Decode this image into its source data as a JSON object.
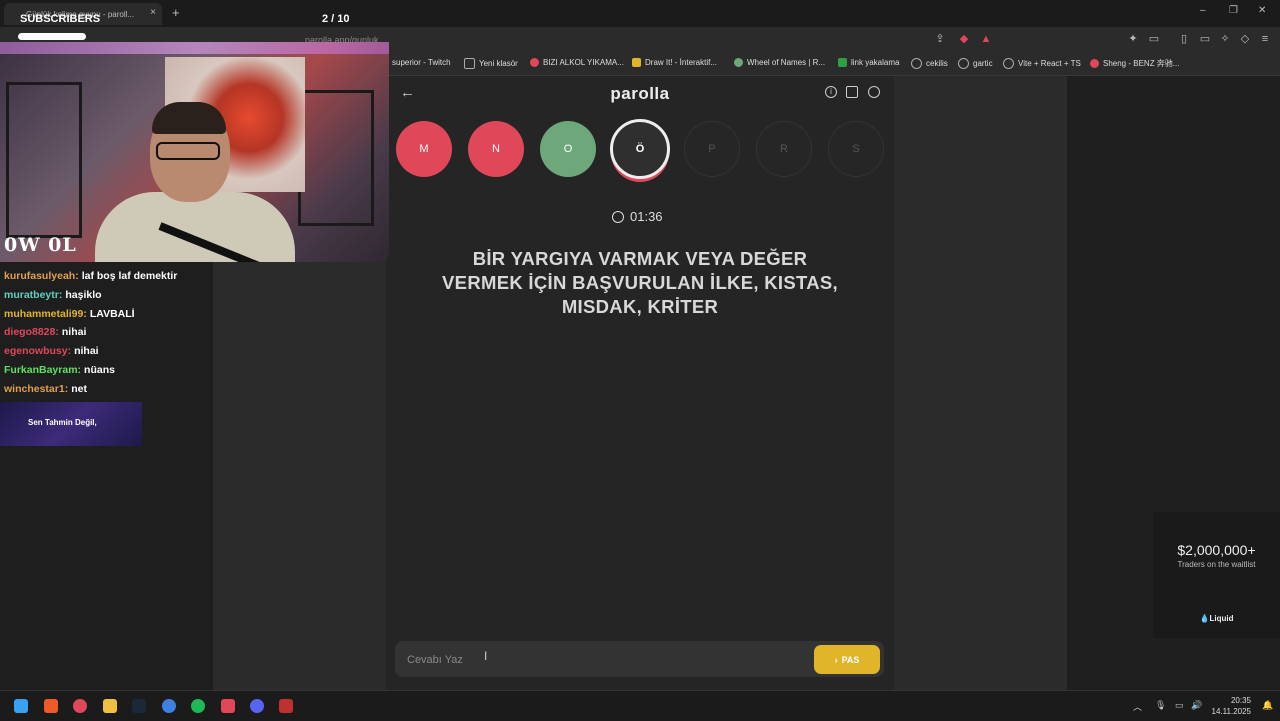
{
  "browser": {
    "tab_title": "Günlük kelime oyunu - paroll...",
    "url": "parolla.app/gunluk",
    "bookmarks": [
      {
        "label": "superior - Twitch",
        "color": "#9146ff"
      },
      {
        "label": "Yeni klasör",
        "color": "#888888"
      },
      {
        "label": "BIZI ALKOL YIKAMA...",
        "color": "#e0485a"
      },
      {
        "label": "Draw It! - İnteraktif...",
        "color": "#e0b52a"
      },
      {
        "label": "Wheel of Names | R...",
        "color": "#6ea87a"
      },
      {
        "label": "link yakalama",
        "color": "#2ea043"
      },
      {
        "label": "cekilis",
        "color": "#888888"
      },
      {
        "label": "gartic",
        "color": "#888888"
      },
      {
        "label": "Vite + React + TS",
        "color": "#888888"
      },
      {
        "label": "Sheng - BENZ 奔驰...",
        "color": "#e0485a"
      }
    ]
  },
  "stream": {
    "subscribers_label": "SUBSCRIBERS",
    "counter": "2  / 10",
    "subs_progress": 0.2,
    "webcam_logo": "0W 0L",
    "chat": [
      {
        "user": "kurufasulyeah:",
        "msg": "laf boş laf demektir",
        "color": "#e0a050"
      },
      {
        "user": "muratbeytr:",
        "msg": "haşiklo",
        "color": "#5fd0c0"
      },
      {
        "user": "muhammetali99:",
        "msg": "LAVBALİ",
        "color": "#e0b52a"
      },
      {
        "user": "diego8828:",
        "msg": "nihai",
        "color": "#e0485a"
      },
      {
        "user": "egenowbusy:",
        "msg": "nihai",
        "color": "#e0485a"
      },
      {
        "user": "FurkanBayram:",
        "msg": "nüans",
        "color": "#5fe060"
      },
      {
        "user": "winchestar1:",
        "msg": "net",
        "color": "#e0a050"
      }
    ],
    "promo_text": "Sen Tahmin Değil,"
  },
  "game": {
    "brand": "parolla",
    "letters": [
      {
        "letter": "M",
        "state": "red"
      },
      {
        "letter": "N",
        "state": "red"
      },
      {
        "letter": "O",
        "state": "green"
      },
      {
        "letter": "Ö",
        "state": "active"
      },
      {
        "letter": "P",
        "state": "empty"
      },
      {
        "letter": "R",
        "state": "empty"
      },
      {
        "letter": "S",
        "state": "empty"
      }
    ],
    "timer": "01:36",
    "question": "BİR YARGIYA VARMAK VEYA DEĞER VERMEK İÇİN BAŞVURULAN İLKE, KISTAS, MISDAK, KRİTER",
    "answer_placeholder": "Cevabı Yaz",
    "pass_label": "PAS",
    "colors": {
      "red": "#e0485a",
      "green": "#6ea87a",
      "accent": "#e0b52a"
    }
  },
  "ad": {
    "amount": "$2,000,000+",
    "subtitle": "Traders on the waitlist",
    "logo": "Liquid"
  },
  "taskbar": {
    "time": "20:35",
    "date": "14.11.2025"
  }
}
